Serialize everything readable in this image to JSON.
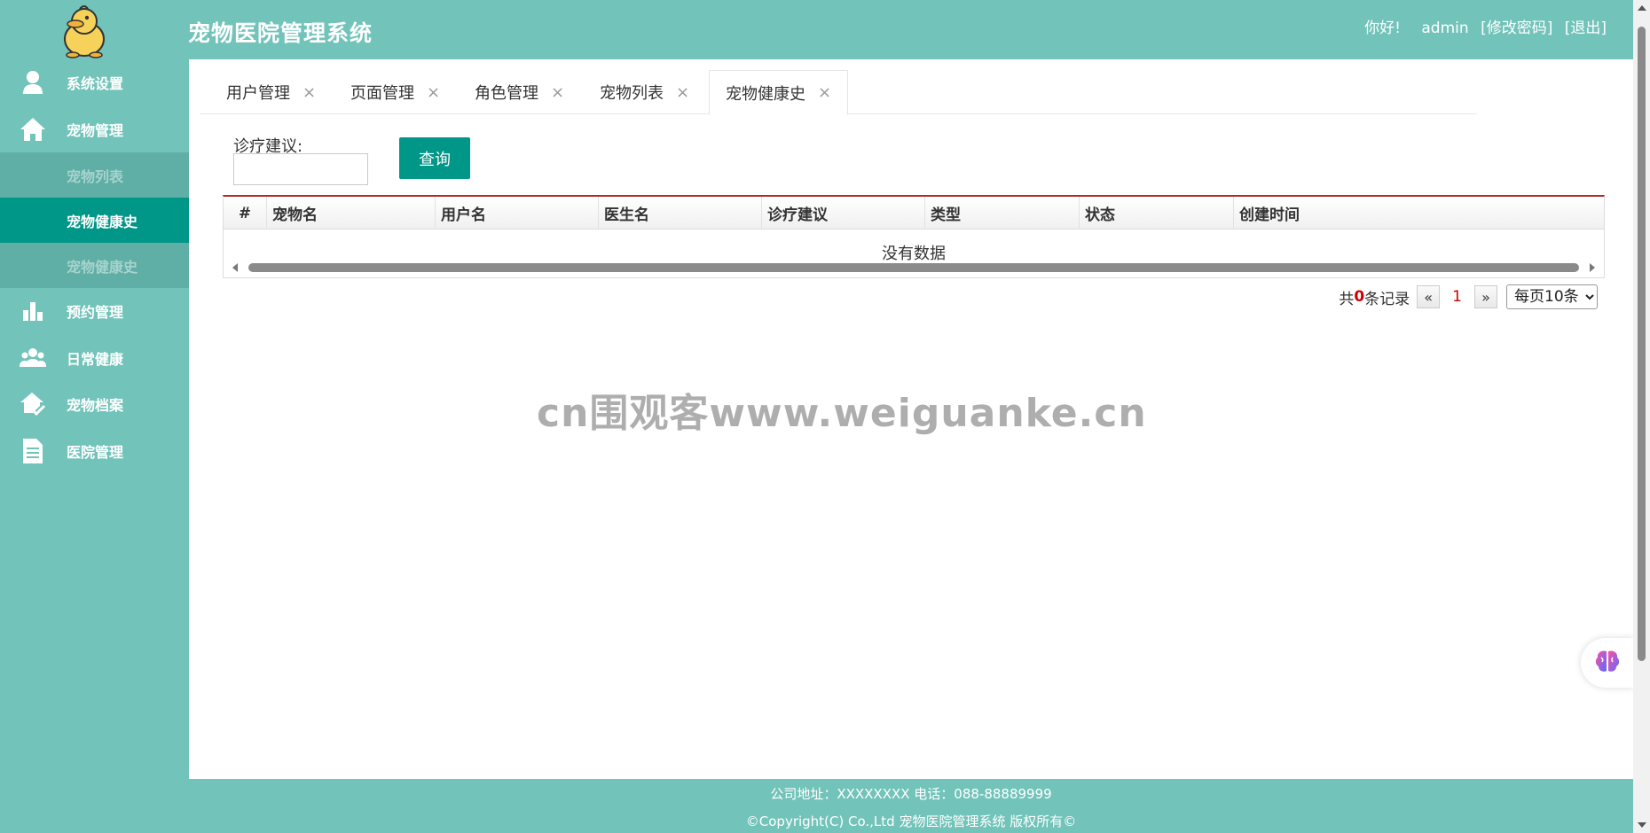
{
  "header": {
    "title": "宠物医院管理系统",
    "greeting": "你好!",
    "username": "admin",
    "change_password": "[修改密码]",
    "logout": "[退出]"
  },
  "sidebar": {
    "items": [
      {
        "label": "系统设置",
        "icon": "user-icon"
      },
      {
        "label": "宠物管理",
        "icon": "home-icon"
      },
      {
        "label": "宠物列表",
        "sub": true,
        "state": "dim"
      },
      {
        "label": "宠物健康史",
        "sub": true,
        "state": "active"
      },
      {
        "label": "宠物健康史",
        "sub": true,
        "state": "dim"
      },
      {
        "label": "预约管理",
        "icon": "bar-chart-icon"
      },
      {
        "label": "日常健康",
        "icon": "group-icon"
      },
      {
        "label": "宠物档案",
        "icon": "house-check-icon"
      },
      {
        "label": "医院管理",
        "icon": "document-icon"
      }
    ]
  },
  "tabs": [
    {
      "label": "用户管理",
      "close": "×"
    },
    {
      "label": "页面管理",
      "close": "×"
    },
    {
      "label": "角色管理",
      "close": "×"
    },
    {
      "label": "宠物列表",
      "close": "×"
    },
    {
      "label": "宠物健康史",
      "close": "×",
      "active": true
    }
  ],
  "search": {
    "label": "诊疗建议:",
    "value": "",
    "button": "查询"
  },
  "table": {
    "columns": [
      "#",
      "宠物名",
      "用户名",
      "医生名",
      "诊疗建议",
      "类型",
      "状态",
      "创建时间"
    ],
    "empty_text": "没有数据"
  },
  "pager": {
    "prefix": "共",
    "count": "0",
    "suffix": "条记录",
    "prev": "«",
    "page": "1",
    "next": "»",
    "page_size": "每页10条"
  },
  "watermark": "cn围观客www.weiguanke.cn",
  "footer": {
    "line1": "公司地址：XXXXXXXX 电话：088-88889999",
    "line2": "©Copyright(C) Co.,Ltd 宠物医院管理系统 版权所有©"
  },
  "colors": {
    "theme": "#72c3ba",
    "active": "#009688",
    "grid_top_border": "#b22a2a"
  }
}
